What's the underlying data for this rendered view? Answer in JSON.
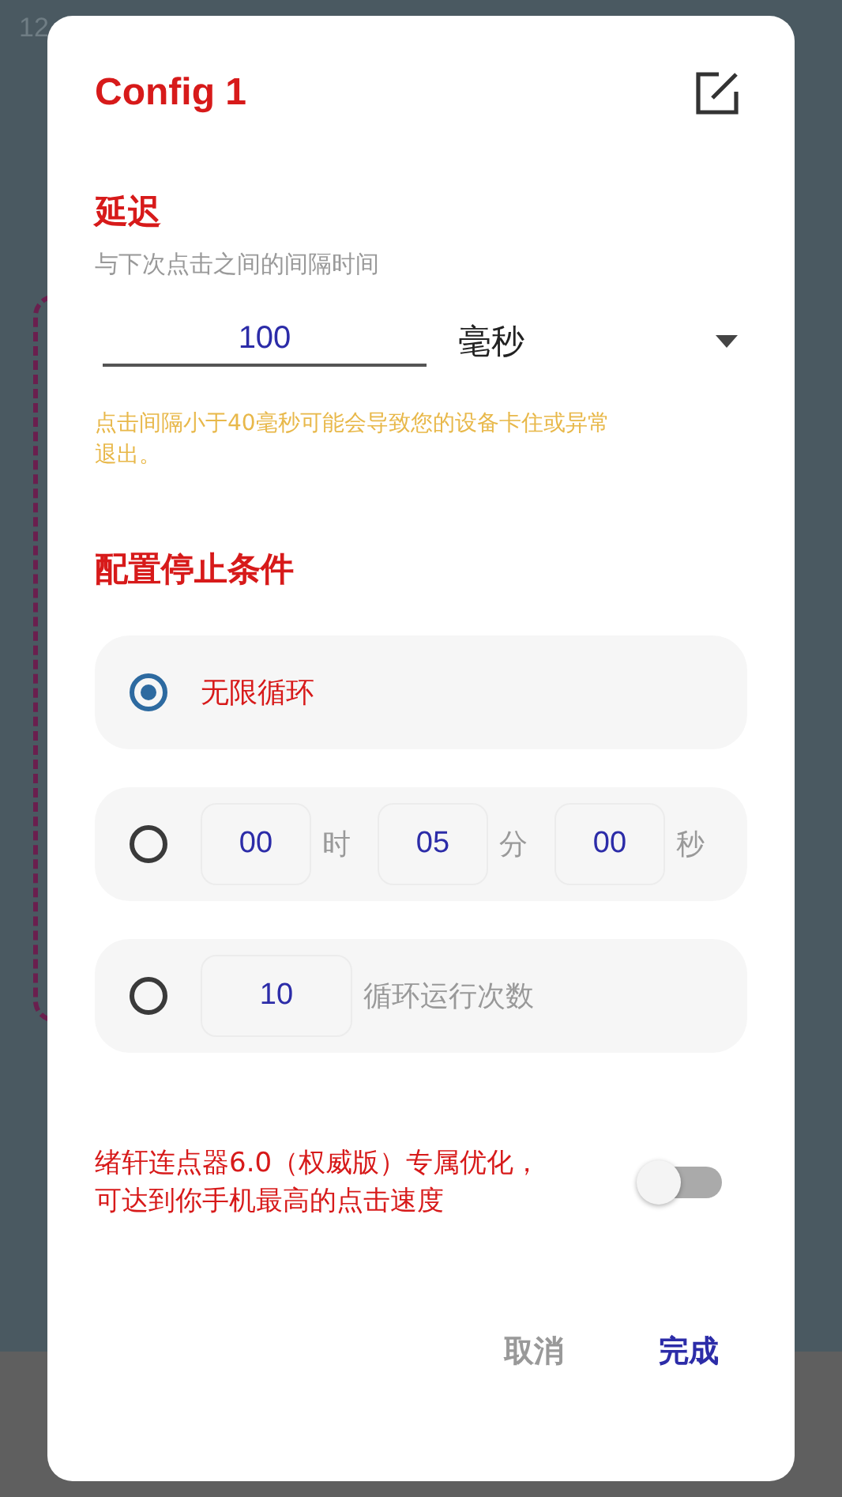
{
  "status_bar": {
    "time": "12"
  },
  "dialog": {
    "title": "Config 1",
    "delay": {
      "heading": "延迟",
      "description": "与下次点击之间的间隔时间",
      "value": "100",
      "unit": "毫秒",
      "warning": "点击间隔小于40毫秒可能会导致您的设备卡住或异常退出。"
    },
    "stop_condition": {
      "heading": "配置停止条件",
      "options": [
        {
          "kind": "label",
          "selected": true,
          "label": "无限循环"
        },
        {
          "kind": "timer",
          "selected": false,
          "fields": [
            {
              "value": "00",
              "unit": "时"
            },
            {
              "value": "05",
              "unit": "分"
            },
            {
              "value": "00",
              "unit": "秒"
            }
          ]
        },
        {
          "kind": "count",
          "selected": false,
          "value": "10",
          "label": "循环运行次数"
        }
      ]
    },
    "optimization": {
      "text": "绪轩连点器6.0（权威版）专属优化，可达到你手机最高的点击速度",
      "on": false
    },
    "buttons": [
      {
        "kind": "cancel",
        "label": "取消"
      },
      {
        "kind": "confirm",
        "label": "完成"
      }
    ]
  }
}
